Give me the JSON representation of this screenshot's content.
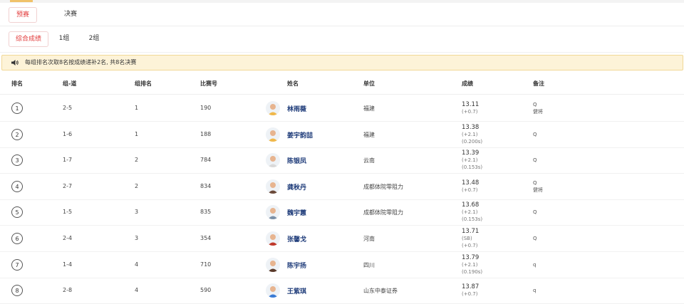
{
  "tabs": [
    {
      "label": "预赛",
      "active": true
    },
    {
      "label": "决赛",
      "active": false
    }
  ],
  "groups": [
    {
      "label": "综合成绩",
      "active": true
    },
    {
      "label": "1组",
      "active": false
    },
    {
      "label": "2组",
      "active": false
    }
  ],
  "notice": {
    "text": "每组排名次取8名按成绩递补2名, 共8名决赛"
  },
  "columns": {
    "rank": "排名",
    "lane": "组-道",
    "group_rank": "组排名",
    "bib": "比赛号",
    "name": "姓名",
    "unit": "单位",
    "result": "成绩",
    "note": "备注"
  },
  "rows": [
    {
      "rank": "1",
      "lane": "2-5",
      "group_rank": "1",
      "bib": "190",
      "name": "林雨薇",
      "unit": "福建",
      "result": "13.11",
      "result_sub1": "(+0.7)",
      "result_sub2": "",
      "note1": "Q",
      "note2": "健将",
      "avatar_color": "#f0b84a"
    },
    {
      "rank": "2",
      "lane": "1-6",
      "group_rank": "1",
      "bib": "188",
      "name": "姜宇韵喆",
      "unit": "福建",
      "result": "13.38",
      "result_sub1": "(+2.1)",
      "result_sub2": "(0.200s)",
      "note1": "Q",
      "note2": "",
      "avatar_color": "#f0b84a"
    },
    {
      "rank": "3",
      "lane": "1-7",
      "group_rank": "2",
      "bib": "784",
      "name": "陈银凤",
      "unit": "云南",
      "result": "13.39",
      "result_sub1": "(+2.1)",
      "result_sub2": "(0.153s)",
      "note1": "Q",
      "note2": "",
      "avatar_color": "#d9d9d9"
    },
    {
      "rank": "4",
      "lane": "2-7",
      "group_rank": "2",
      "bib": "834",
      "name": "龚秋丹",
      "unit": "成都体院零阻力",
      "result": "13.48",
      "result_sub1": "(+0.7)",
      "result_sub2": "",
      "note1": "Q",
      "note2": "健将",
      "avatar_color": "#6b4a3a"
    },
    {
      "rank": "5",
      "lane": "1-5",
      "group_rank": "3",
      "bib": "835",
      "name": "魏宇蕙",
      "unit": "成都体院零阻力",
      "result": "13.68",
      "result_sub1": "(+2.1)",
      "result_sub2": "(0.153s)",
      "note1": "Q",
      "note2": "",
      "avatar_color": "#7a90a8"
    },
    {
      "rank": "6",
      "lane": "2-4",
      "group_rank": "3",
      "bib": "354",
      "name": "张馨戈",
      "unit": "河南",
      "result": "13.71",
      "result_sub1": "(SB)",
      "result_sub2": "(+0.7)",
      "note1": "Q",
      "note2": "",
      "avatar_color": "#c0392b"
    },
    {
      "rank": "7",
      "lane": "1-4",
      "group_rank": "4",
      "bib": "710",
      "name": "陈宇扬",
      "unit": "四川",
      "result": "13.79",
      "result_sub1": "(+2.1)",
      "result_sub2": "(0.190s)",
      "note1": "q",
      "note2": "",
      "avatar_color": "#5a3a2a"
    },
    {
      "rank": "8",
      "lane": "2-8",
      "group_rank": "4",
      "bib": "590",
      "name": "王紫琪",
      "unit": "山东中泰证券",
      "result": "13.87",
      "result_sub1": "(+0.7)",
      "result_sub2": "",
      "note1": "q",
      "note2": "",
      "avatar_color": "#3a7bd5"
    }
  ],
  "colors": {
    "accent": "#e23a3a",
    "notice_bg": "#fdf3d8",
    "name": "#1f3c7a"
  }
}
